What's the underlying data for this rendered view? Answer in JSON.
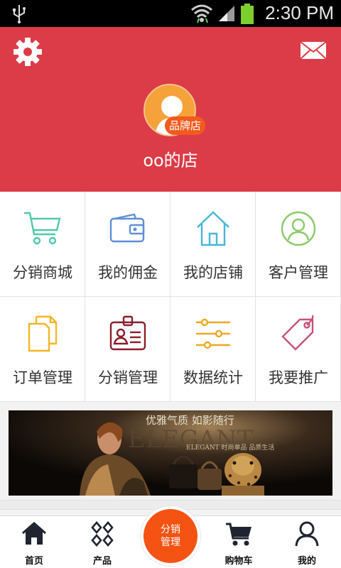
{
  "status_bar": {
    "time": "2:30 PM"
  },
  "header": {
    "shop_badge": "品牌店",
    "shop_name": "oo的店"
  },
  "menu": [
    {
      "label": "分销商城",
      "icon": "cart-icon"
    },
    {
      "label": "我的佣金",
      "icon": "wallet-icon"
    },
    {
      "label": "我的店铺",
      "icon": "home-icon"
    },
    {
      "label": "客户管理",
      "icon": "customer-icon"
    },
    {
      "label": "订单管理",
      "icon": "documents-icon"
    },
    {
      "label": "分销管理",
      "icon": "id-card-icon"
    },
    {
      "label": "数据统计",
      "icon": "sliders-icon"
    },
    {
      "label": "我要推广",
      "icon": "tag-icon"
    }
  ],
  "banner": {
    "headline": "优雅气质 如影随行",
    "subline": "ELEGANT 时尚单品 品质生活"
  },
  "tabbar": {
    "home": "首页",
    "products": "产品",
    "center_line1": "分销",
    "center_line2": "管理",
    "cart": "购物车",
    "mine": "我的"
  },
  "colors": {
    "header_bg": "#dc3b48",
    "accent_orange": "#f55313",
    "cart_teal": "#4fc9a8",
    "wallet_blue": "#5d8fd6",
    "home_cyan": "#46b7d6",
    "customer_green": "#8bc96a",
    "doc_yellow": "#f3b624",
    "idcard_maroon": "#8b1c2a",
    "sliders_amber": "#f0a822",
    "tag_pink": "#c8507a"
  }
}
